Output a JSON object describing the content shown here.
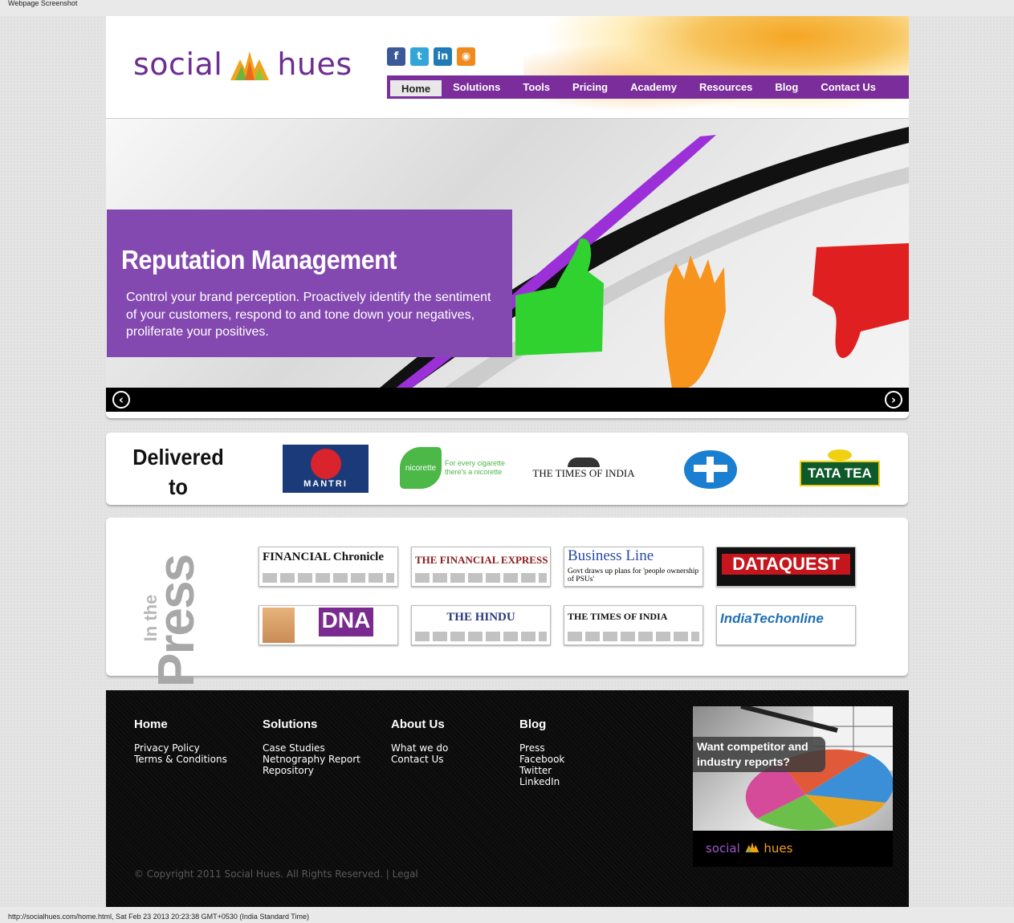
{
  "caption": "Webpage Screenshot",
  "capture_info": "http://socialhues.com/home.html, Sat Feb 23 2013 20:23:38 GMT+0530 (India Standard Time)",
  "brand": {
    "word1": "social",
    "word2": "hues",
    "colors": {
      "purple": "#6d2d91",
      "accent_orange": "#f5a623",
      "nav_purple": "#7b2d9b"
    }
  },
  "social_icons": [
    {
      "icon": "facebook-icon",
      "glyph": "f",
      "color": "#3b5998"
    },
    {
      "icon": "twitter-icon",
      "glyph": "t",
      "color": "#33a6d9"
    },
    {
      "icon": "linkedin-icon",
      "glyph": "in",
      "color": "#1f7bb6"
    },
    {
      "icon": "rss-icon",
      "glyph": "◉",
      "color": "#f08a1d"
    }
  ],
  "nav": [
    "Home",
    "Solutions",
    "Tools",
    "Pricing",
    "Academy",
    "Resources",
    "Blog",
    "Contact Us"
  ],
  "nav_active": "Home",
  "hero": {
    "title": "Reputation Management",
    "text": "Control your brand perception. Proactively identify the sentiment of your customers, respond to and tone down your negatives, proliferate your positives.",
    "prev_icon": "‹",
    "next_icon": "›"
  },
  "delivered": {
    "title_line1": "Delivered",
    "title_line2": "to",
    "clients": [
      {
        "name": "mantri",
        "label": "MANTRI"
      },
      {
        "name": "nicorette",
        "label": "nicorette",
        "tagline": "For every cigarette there's a nicorette"
      },
      {
        "name": "times-of-india",
        "label": "THE TIMES OF INDIA"
      },
      {
        "name": "cp",
        "label": ""
      },
      {
        "name": "tata-tea",
        "label": "TATA TEA"
      }
    ]
  },
  "press": {
    "label_top": "In the",
    "label_main": "Press",
    "clips": [
      {
        "name": "financial-chronicle",
        "title": "FINANCIAL Chronicle"
      },
      {
        "name": "financial-express",
        "title": "THE FINANCIAL EXPRESS"
      },
      {
        "name": "business-line",
        "title": "Business Line",
        "sub": "Govt draws up plans for 'people ownership of PSUs'"
      },
      {
        "name": "dataquest",
        "title": "DATAQUEST"
      },
      {
        "name": "dna",
        "title": "DNA"
      },
      {
        "name": "the-hindu",
        "title": "THE HINDU"
      },
      {
        "name": "times-of-india-clip",
        "title": "THE TIMES OF INDIA"
      },
      {
        "name": "indiatech-online",
        "title": "IndiaTechonline"
      }
    ]
  },
  "footer": {
    "columns": [
      {
        "heading": "Home",
        "links": [
          "Privacy Policy",
          "Terms & Conditions"
        ]
      },
      {
        "heading": "Solutions",
        "links": [
          "Case Studies",
          "Netnography Report",
          "Repository"
        ]
      },
      {
        "heading": "About Us",
        "links": [
          "What we do",
          "Contact Us"
        ]
      },
      {
        "heading": "Blog",
        "links": [
          "Press",
          "Facebook",
          "Twitter",
          "LinkedIn"
        ]
      }
    ],
    "copyright": "© Copyright 2011 Social Hues. All Rights Reserved. | Legal",
    "promo": {
      "line1": "Want competitor and",
      "line2": "industry reports?",
      "logo_word1": "social",
      "logo_word2": "hues"
    }
  }
}
